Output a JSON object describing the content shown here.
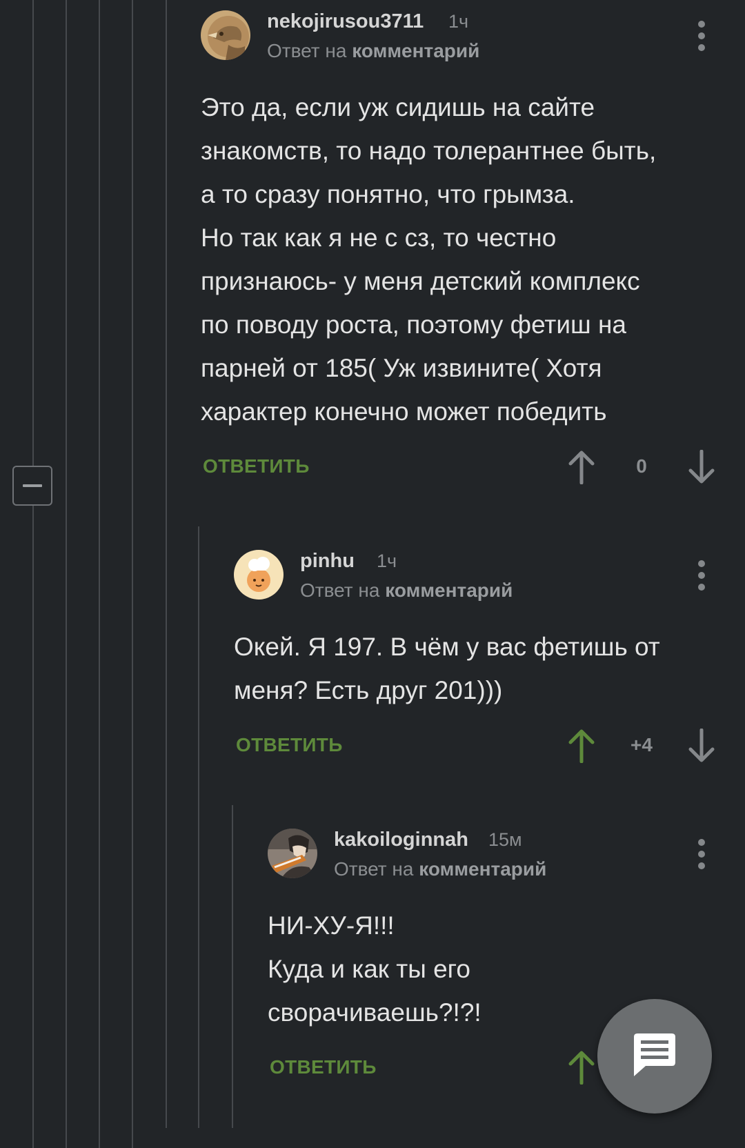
{
  "colors": {
    "background": "#222528",
    "thread_line": "#46494d",
    "reply_button": "#5e8a3b",
    "vote_up_active": "#5e8a3b",
    "vote_neutral": "#85888b"
  },
  "comments": [
    {
      "author": "nekojirusou3711",
      "time": "1ч",
      "reply_prefix": "Ответ на",
      "reply_target": "комментарий",
      "text": "Это да, если уж сидишь на сайте\nзнакомств, то надо толерантнее быть,\nа то сразу понятно, что грымза.\nНо так как я не с сз, то честно\nпризнаюсь- у меня детский комплекс\nпо поводу роста, поэтому фетиш на\nпарней от 185( Уж извините( Хотя\nхарактер конечно может победить",
      "reply_label": "ОТВЕТИТЬ",
      "rating": "0",
      "upvoted": false
    },
    {
      "author": "pinhu",
      "time": "1ч",
      "reply_prefix": "Ответ на",
      "reply_target": "комментарий",
      "text": "Окей. Я 197. В чём у вас фетишь от\nменя? Есть друг 201)))",
      "reply_label": "ОТВЕТИТЬ",
      "rating": "+4",
      "upvoted": true
    },
    {
      "author": "kakoiloginnah",
      "time": "15м",
      "reply_prefix": "Ответ на",
      "reply_target": "комментарий",
      "text": "НИ-ХУ-Я!!!\nКуда и как  ты его\nсворачиваешь?!?!",
      "reply_label": "ОТВЕТИТЬ",
      "upvoted": true
    }
  ],
  "icons": {
    "collapse": "minus-square-icon",
    "more": "more-vertical-icon",
    "upvote": "arrow-up-icon",
    "downvote": "arrow-down-icon",
    "fab": "comment-icon"
  }
}
